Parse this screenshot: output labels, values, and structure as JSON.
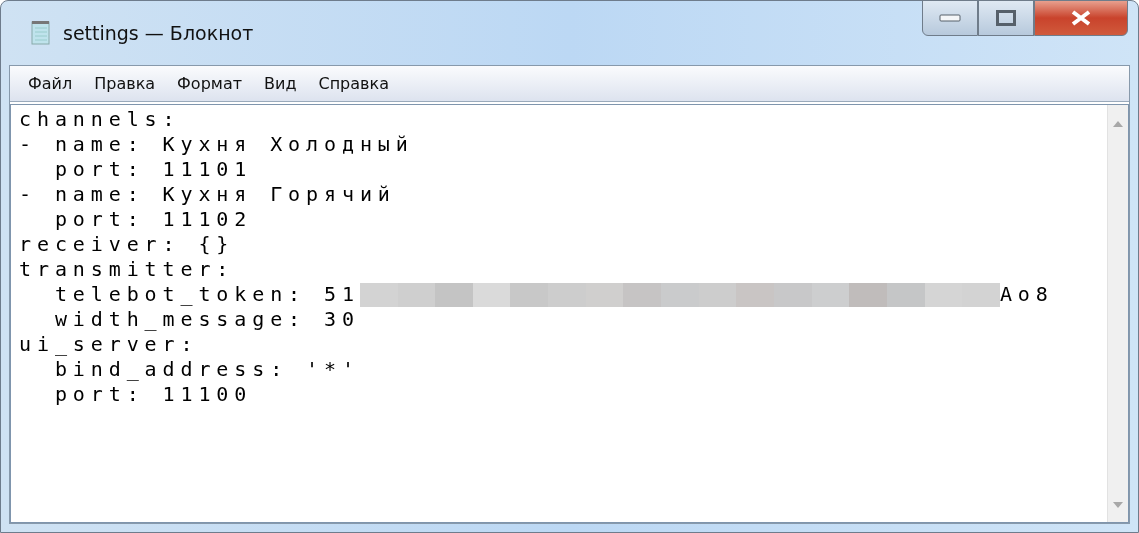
{
  "window": {
    "title": "settings — Блокнот"
  },
  "menu": [
    "Файл",
    "Правка",
    "Формат",
    "Вид",
    "Справка"
  ],
  "lines": [
    {
      "kind": "text",
      "text": "channels:"
    },
    {
      "kind": "text",
      "text": "- name: Кухня Холодный"
    },
    {
      "kind": "text",
      "text": "  port: 11101"
    },
    {
      "kind": "text",
      "text": "- name: Кухня Горячий"
    },
    {
      "kind": "text",
      "text": "  port: 11102"
    },
    {
      "kind": "text",
      "text": "receiver: {}"
    },
    {
      "kind": "text",
      "text": "transmitter:"
    },
    {
      "kind": "redacted",
      "before": "  telebot_token: 51",
      "after": "Ao8"
    },
    {
      "kind": "text",
      "text": "  width_message: 30"
    },
    {
      "kind": "text",
      "text": "ui_server:"
    },
    {
      "kind": "text",
      "text": "  bind_address: '*'"
    },
    {
      "kind": "text",
      "text": "  port: 11100"
    }
  ]
}
